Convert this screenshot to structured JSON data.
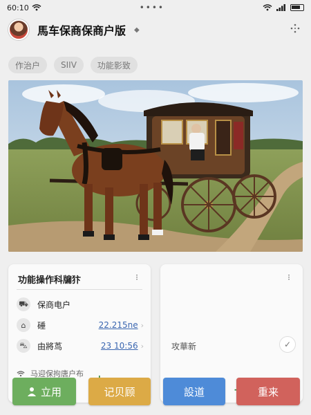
{
  "status": {
    "time": "60:10",
    "dots": "••••"
  },
  "header": {
    "title": "馬车保商保商户版",
    "title_icon": "◆"
  },
  "chips": [
    "作治户",
    "SIIV",
    "功能影致"
  ],
  "card_left": {
    "title": "功能操作科牖犿",
    "more": "⁝",
    "rows": [
      {
        "icon": "carriage-icon",
        "label": "保商电户",
        "value": ""
      },
      {
        "icon": "seat-icon",
        "label": "硾",
        "value": "22.215ne"
      },
      {
        "icon": "cart-icon",
        "label": "由將茑",
        "value": "23 10:56"
      }
    ],
    "footer": "马迎保拘唐户布"
  },
  "card_right": {
    "more": "⁝",
    "label": "攻華新",
    "check": "✓"
  },
  "buttons": {
    "b1": "立用",
    "b2": "记贝顾",
    "b3": "設道",
    "b4": "重来"
  },
  "colors": {
    "green": "#6dae5e",
    "yellow": "#dcaa46",
    "blue": "#4e8bd8",
    "red": "#d1625c"
  }
}
